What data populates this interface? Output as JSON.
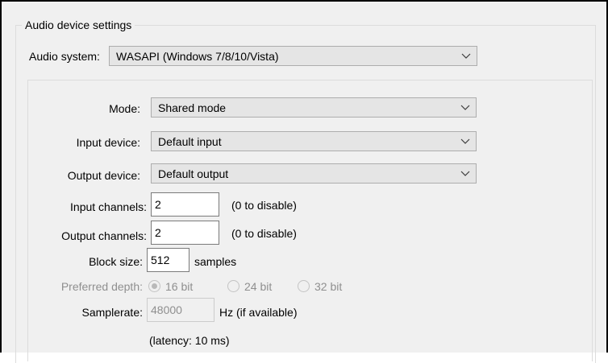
{
  "group": {
    "title": "Audio device settings"
  },
  "audio_system": {
    "label": "Audio system:",
    "value": "WASAPI (Windows 7/8/10/Vista)"
  },
  "mode": {
    "label": "Mode:",
    "value": "Shared mode"
  },
  "input_device": {
    "label": "Input device:",
    "value": "Default input"
  },
  "output_device": {
    "label": "Output device:",
    "value": "Default output"
  },
  "input_channels": {
    "label": "Input channels:",
    "value": "2",
    "hint": "(0 to disable)"
  },
  "output_channels": {
    "label": "Output channels:",
    "value": "2",
    "hint": "(0 to disable)"
  },
  "block_size": {
    "label": "Block size:",
    "value": "512",
    "unit": "samples"
  },
  "preferred_depth": {
    "label": "Preferred depth:",
    "options": [
      "16 bit",
      "24 bit",
      "32 bit"
    ],
    "selected": "16 bit",
    "enabled": false
  },
  "samplerate": {
    "label": "Samplerate:",
    "value": "48000",
    "unit": "Hz (if available)",
    "enabled": false
  },
  "latency": {
    "text": "(latency: 10 ms)"
  },
  "icons": {
    "dropdown": "chevron-down-icon",
    "radio_selected": "radio-selected-icon",
    "radio_unselected": "radio-unselected-icon"
  }
}
